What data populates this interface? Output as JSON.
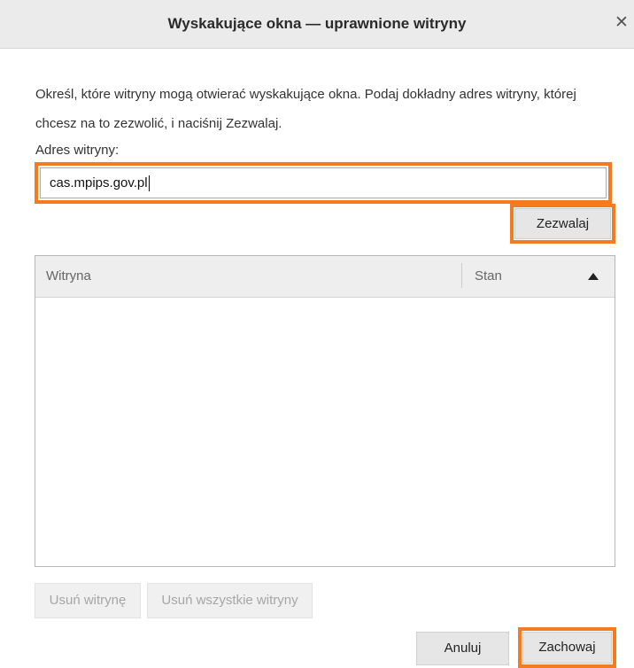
{
  "dialog": {
    "title": "Wyskakujące okna — uprawnione witryny",
    "close_symbol": "✕",
    "description": "Określ, które witryny mogą otwierać wyskakujące okna. Podaj dokładny adres witryny, której chcesz na to zezwolić, i naciśnij Zezwalaj.",
    "address_label": "Adres witryny:",
    "address_value": "cas.mpips.gov.pl",
    "allow_button": "Zezwalaj",
    "table": {
      "columns": [
        "Witryna",
        "Stan"
      ],
      "sort_icon": "sort-ascending-icon",
      "rows": []
    },
    "remove_site_button": "Usuń witrynę",
    "remove_all_button": "Usuń wszystkie witryny",
    "cancel_button": "Anuluj",
    "save_button": "Zachowaj"
  },
  "colors": {
    "highlight": "#f47b20",
    "titlebar": "#ebebeb",
    "button": "#e6e6e6"
  }
}
